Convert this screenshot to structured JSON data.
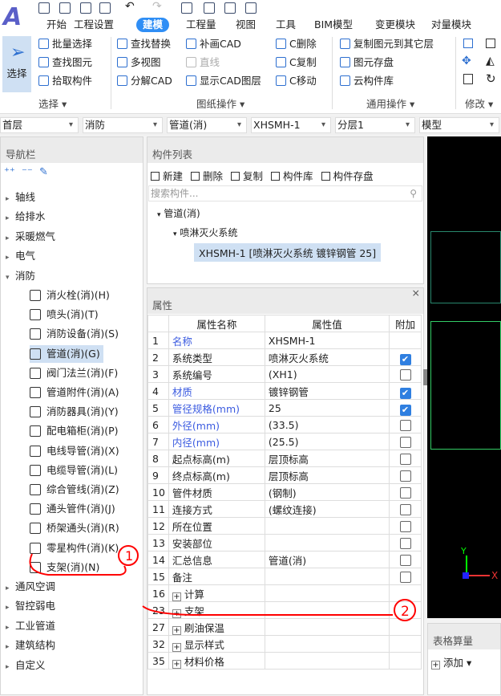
{
  "app": {
    "logo": "A",
    "tabs": [
      "开始",
      "工程设置",
      "建模",
      "工程量",
      "视图",
      "工具",
      "BIM模型",
      "变更模块",
      "对量模块"
    ],
    "active_tab": "建模"
  },
  "ribbon": {
    "select": {
      "main": "选择",
      "items": [
        "批量选择",
        "查找图元",
        "拾取构件"
      ],
      "label": "选择"
    },
    "drawing": {
      "col1": [
        "查找替换",
        "多视图",
        "分解CAD"
      ],
      "col2": [
        "补画CAD",
        "直线",
        "显示CAD图层"
      ],
      "col3": [
        "C删除",
        "C复制",
        "C移动"
      ],
      "label": "图纸操作"
    },
    "general": {
      "items": [
        "复制图元到其它层",
        "图元存盘",
        "云构件库"
      ],
      "label": "通用操作"
    },
    "modify": {
      "label": "修改"
    }
  },
  "dropdowns": [
    "首层",
    "消防",
    "管道(消)",
    "XHSMH-1",
    "分层1",
    "模型"
  ],
  "nav": {
    "title": "导航栏",
    "items": [
      "轴线",
      "给排水",
      "采暖燃气",
      "电气",
      "消防"
    ],
    "sub": [
      "消火栓(消)(H)",
      "喷头(消)(T)",
      "消防设备(消)(S)",
      "管道(消)(G)",
      "阀门法兰(消)(F)",
      "管道附件(消)(A)",
      "消防器具(消)(Y)",
      "配电箱柜(消)(P)",
      "电线导管(消)(X)",
      "电缆导管(消)(L)",
      "综合管线(消)(Z)",
      "通头管件(消)(J)",
      "桥架通头(消)(R)",
      "零星构件(消)(K)",
      "支架(消)(N)"
    ],
    "selected_sub": "管道(消)(G)",
    "items_after": [
      "通风空调",
      "智控弱电",
      "工业管道",
      "建筑结构",
      "自定义"
    ]
  },
  "component_list": {
    "title": "构件列表",
    "toolbar": [
      "新建",
      "删除",
      "复制",
      "构件库",
      "构件存盘"
    ],
    "search_placeholder": "搜索构件...",
    "tree": {
      "root": "管道(消)",
      "child": "喷淋灭火系统",
      "leaf": "XHSMH-1 [喷淋灭火系统 镀锌钢管 25]"
    }
  },
  "properties": {
    "title": "属性",
    "headers": [
      "属性名称",
      "属性值",
      "附加"
    ],
    "rows": [
      {
        "n": "1",
        "name": "名称",
        "value": "XHSMH-1",
        "blue": true,
        "cb": null
      },
      {
        "n": "2",
        "name": "系统类型",
        "value": "喷淋灭火系统",
        "blue": false,
        "cb": true
      },
      {
        "n": "3",
        "name": "系统编号",
        "value": "(XH1)",
        "blue": false,
        "cb": false
      },
      {
        "n": "4",
        "name": "材质",
        "value": "镀锌钢管",
        "blue": true,
        "cb": true
      },
      {
        "n": "5",
        "name": "管径规格(mm)",
        "value": "25",
        "blue": true,
        "cb": true
      },
      {
        "n": "6",
        "name": "外径(mm)",
        "value": "(33.5)",
        "blue": true,
        "cb": false
      },
      {
        "n": "7",
        "name": "内径(mm)",
        "value": "(25.5)",
        "blue": true,
        "cb": false
      },
      {
        "n": "8",
        "name": "起点标高(m)",
        "value": "层顶标高",
        "blue": false,
        "cb": false
      },
      {
        "n": "9",
        "name": "终点标高(m)",
        "value": "层顶标高",
        "blue": false,
        "cb": false
      },
      {
        "n": "10",
        "name": "管件材质",
        "value": "(钢制)",
        "blue": false,
        "cb": false
      },
      {
        "n": "11",
        "name": "连接方式",
        "value": "(螺纹连接)",
        "blue": false,
        "cb": false
      },
      {
        "n": "12",
        "name": "所在位置",
        "value": "",
        "blue": false,
        "cb": false
      },
      {
        "n": "13",
        "name": "安装部位",
        "value": "",
        "blue": false,
        "cb": false
      },
      {
        "n": "14",
        "name": "汇总信息",
        "value": "管道(消)",
        "blue": false,
        "cb": false
      },
      {
        "n": "15",
        "name": "备注",
        "value": "",
        "blue": false,
        "cb": false
      }
    ],
    "groups": [
      {
        "n": "16",
        "name": "计算"
      },
      {
        "n": "23",
        "name": "支架"
      },
      {
        "n": "27",
        "name": "刷油保温"
      },
      {
        "n": "32",
        "name": "显示样式"
      },
      {
        "n": "35",
        "name": "材料价格"
      }
    ]
  },
  "table_calc": {
    "title": "表格算量",
    "add": "添加"
  },
  "annotations": [
    "1",
    "2"
  ],
  "colors": {
    "accent": "#2f8ef5",
    "annotation": "#ff0000",
    "canvas": "#000000"
  }
}
